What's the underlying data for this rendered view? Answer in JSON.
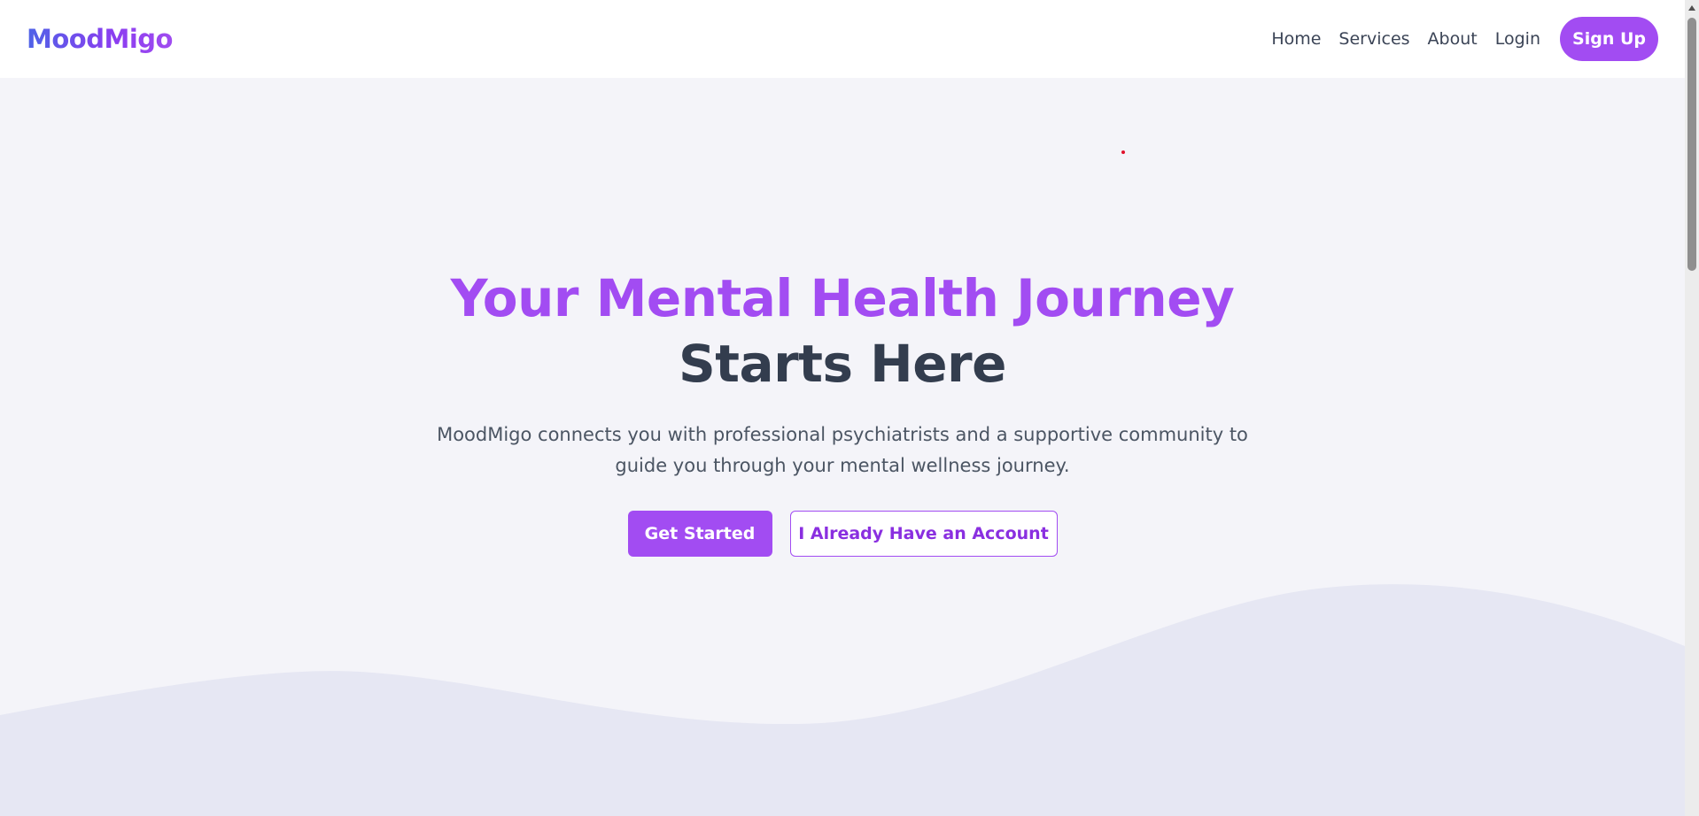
{
  "header": {
    "brand": "MoodMigo",
    "nav": {
      "home": "Home",
      "services": "Services",
      "about": "About",
      "login": "Login",
      "signup": "Sign Up"
    }
  },
  "hero": {
    "title_line1": "Your Mental Health Journey",
    "title_line2": "Starts Here",
    "description": "MoodMigo connects you with professional psychiatrists and a supportive community to guide you through your mental wellness journey.",
    "primary_button": "Get Started",
    "secondary_button": "I Already Have an Account"
  },
  "colors": {
    "accent": "#a24cf2",
    "brand_gradient_start": "#4f63e7",
    "heading_dark": "#333d4e",
    "background": "#f4f4f9",
    "wave": "#e6e7f3"
  }
}
